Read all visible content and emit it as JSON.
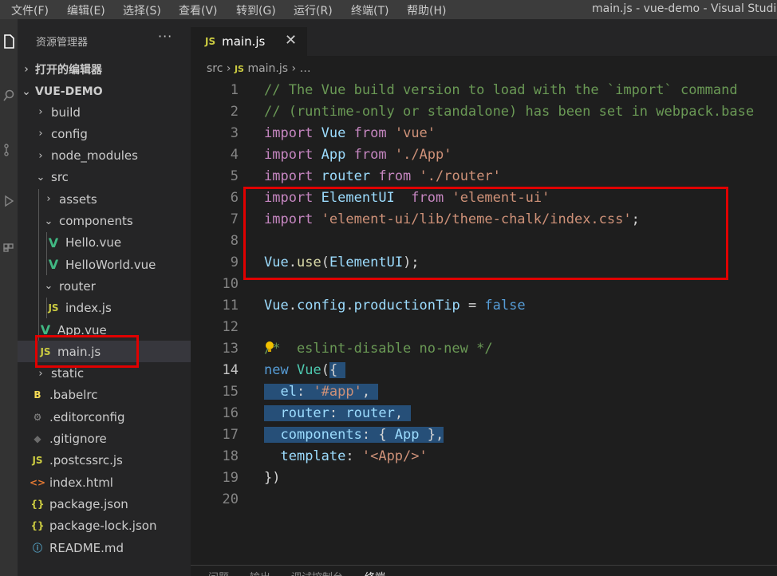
{
  "menu": [
    "文件(F)",
    "编辑(E)",
    "选择(S)",
    "查看(V)",
    "转到(G)",
    "运行(R)",
    "终端(T)",
    "帮助(H)"
  ],
  "window_title": "main.js - vue-demo - Visual Studio C",
  "sidebar": {
    "title": "资源管理器",
    "more": "···",
    "open_editors": "打开的编辑器",
    "project": "VUE-DEMO",
    "items": [
      {
        "label": "build",
        "icon": "folder-closed",
        "chev": "›"
      },
      {
        "label": "config",
        "icon": "folder-closed",
        "chev": "›"
      },
      {
        "label": "node_modules",
        "icon": "folder-closed",
        "chev": "›"
      },
      {
        "label": "src",
        "icon": "folder-open",
        "chev": "⌄"
      },
      {
        "label": "assets",
        "icon": "folder-closed",
        "chev": "›"
      },
      {
        "label": "components",
        "icon": "folder-open",
        "chev": "⌄"
      },
      {
        "label": "Hello.vue",
        "icon": "vue-icon",
        "glyph": "V"
      },
      {
        "label": "HelloWorld.vue",
        "icon": "vue-icon",
        "glyph": "V"
      },
      {
        "label": "router",
        "icon": "folder-open",
        "chev": "⌄"
      },
      {
        "label": "index.js",
        "icon": "js-icon",
        "glyph": "JS"
      },
      {
        "label": "App.vue",
        "icon": "vue-icon",
        "glyph": "V"
      },
      {
        "label": "main.js",
        "icon": "js-icon",
        "glyph": "JS"
      },
      {
        "label": "static",
        "icon": "folder-closed",
        "chev": "›"
      },
      {
        "label": ".babelrc",
        "icon": "babel-icon",
        "glyph": "B"
      },
      {
        "label": ".editorconfig",
        "icon": "gear-icon",
        "glyph": "⚙"
      },
      {
        "label": ".gitignore",
        "icon": "git-icon",
        "glyph": "◆"
      },
      {
        "label": ".postcssrc.js",
        "icon": "js-icon",
        "glyph": "JS"
      },
      {
        "label": "index.html",
        "icon": "html-icon",
        "glyph": "<>"
      },
      {
        "label": "package.json",
        "icon": "json-icon",
        "glyph": "{}"
      },
      {
        "label": "package-lock.json",
        "icon": "json-icon",
        "glyph": "{}"
      },
      {
        "label": "README.md",
        "icon": "info-icon",
        "glyph": "ⓘ"
      }
    ]
  },
  "tab": {
    "label": "main.js",
    "glyph": "JS",
    "close": "✕"
  },
  "breadcrumb": {
    "folder": "src",
    "sep": "›",
    "glyph": "JS",
    "file": "main.js",
    "rest": "…"
  },
  "code": {
    "line_numbers": [
      "1",
      "2",
      "3",
      "4",
      "5",
      "6",
      "7",
      "8",
      "9",
      "10",
      "11",
      "12",
      "13",
      "14",
      "15",
      "16",
      "17",
      "18",
      "19",
      "20"
    ]
  },
  "panel_tabs": [
    "问题",
    "输出",
    "调试控制台",
    "终端"
  ],
  "colors": {
    "annotation": "#e00000",
    "selection": "#264f78",
    "vue": "#41b883",
    "js": "#cbcb41"
  }
}
